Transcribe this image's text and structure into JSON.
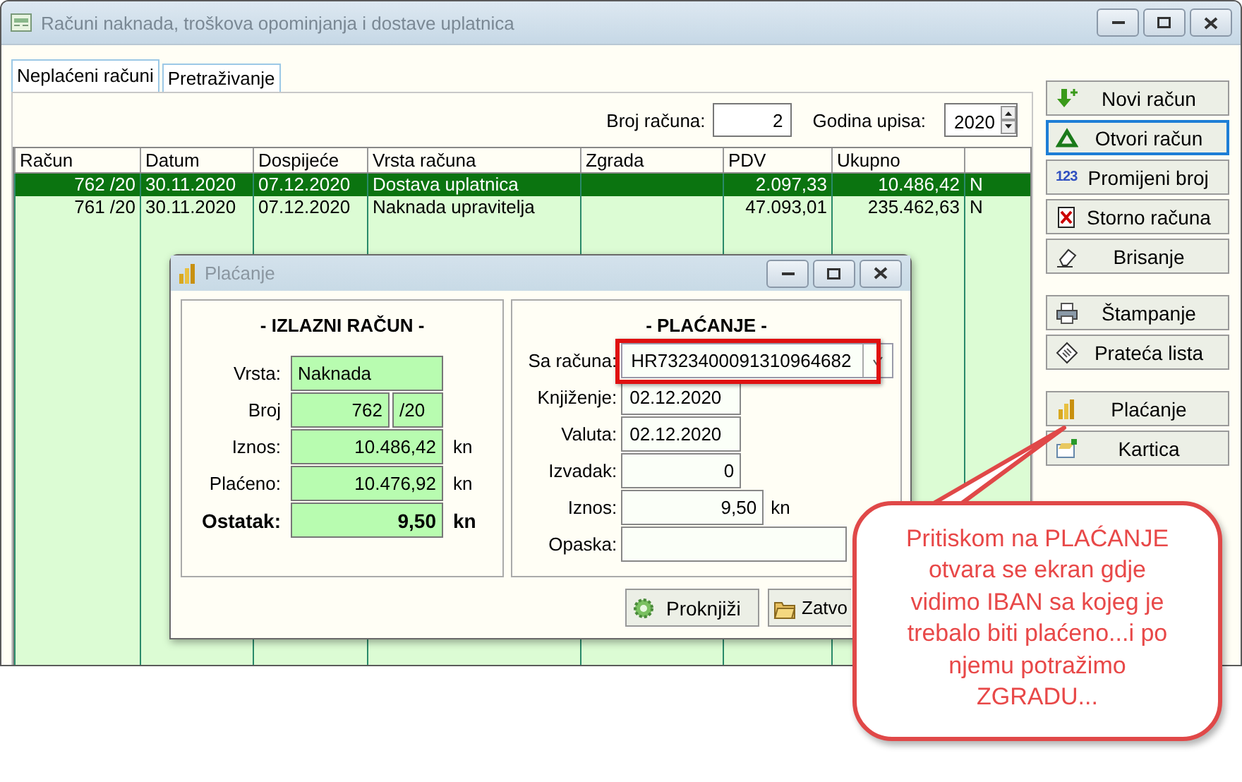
{
  "window": {
    "title": "Računi naknada, troškova opominjanja i dostave uplatnica"
  },
  "tabs": [
    {
      "label": "Neplaćeni računi",
      "selected": true
    },
    {
      "label": "Pretraživanje",
      "selected": false
    }
  ],
  "filters": {
    "count_label": "Broj računa:",
    "count": "2",
    "year_label": "Godina upisa:",
    "year": "2020"
  },
  "table": {
    "columns": [
      "Račun",
      "Datum",
      "Dospijeće",
      "Vrsta računa",
      "Zgrada",
      "PDV",
      "Ukupno"
    ],
    "rows": [
      {
        "selected": true,
        "cells": [
          "762 /20",
          "30.11.2020",
          "07.12.2020",
          "Dostava uplatnica",
          "",
          "2.097,33",
          "10.486,42",
          "N"
        ]
      },
      {
        "selected": false,
        "cells": [
          "761 /20",
          "30.11.2020",
          "07.12.2020",
          "Naknada upravitelja",
          "",
          "47.093,01",
          "235.462,63",
          "N"
        ]
      }
    ]
  },
  "action_groups": [
    [
      {
        "label": "Novi račun",
        "kind": "add",
        "focused": false
      },
      {
        "label": "Otvori račun",
        "kind": "open",
        "focused": true
      },
      {
        "label": "Promijeni broj",
        "kind": "digits",
        "icon_text": "123",
        "focused": false
      },
      {
        "label": "Storno računa",
        "kind": "cancel",
        "focused": false
      },
      {
        "label": "Brisanje",
        "kind": "erase",
        "focused": false
      }
    ],
    [
      {
        "label": "Štampanje",
        "kind": "print",
        "focused": false
      },
      {
        "label": "Prateća lista",
        "kind": "list",
        "focused": false
      }
    ],
    [
      {
        "label": "Plaćanje",
        "kind": "pay",
        "focused": false
      },
      {
        "label": "Kartica",
        "kind": "card",
        "focused": false
      }
    ]
  ],
  "dialog": {
    "title": "Plaćanje",
    "invoice": {
      "heading": "- IZLAZNI RAČUN -",
      "fields": [
        {
          "label": "Vrsta:",
          "kind": "text",
          "value": "Naknada"
        },
        {
          "label": "Broj",
          "kind": "split",
          "value": "762",
          "suffix": "/20"
        },
        {
          "label": "Iznos:",
          "kind": "amount",
          "value": "10.486,42",
          "unit": "kn"
        },
        {
          "label": "Plaćeno:",
          "kind": "amount",
          "value": "10.476,92",
          "unit": "kn"
        },
        {
          "label": "Ostatak:",
          "kind": "total",
          "value": "9,50",
          "unit": "kn"
        }
      ]
    },
    "payment": {
      "heading": "- PLAĆANJE -",
      "fields": [
        {
          "label": "Sa računa:",
          "kind": "combo",
          "value": "HR7323400091310964682",
          "highlighted": true
        },
        {
          "label": "Knjiženje:",
          "kind": "date",
          "value": "02.12.2020"
        },
        {
          "label": "Valuta:",
          "kind": "date",
          "value": "02.12.2020"
        },
        {
          "label": "Izvadak:",
          "kind": "number",
          "value": "0"
        },
        {
          "label": "Iznos:",
          "kind": "amount",
          "value": "9,50",
          "unit": "kn"
        },
        {
          "label": "Opaska:",
          "kind": "note"
        }
      ]
    },
    "buttons": [
      {
        "label": "Proknjiži",
        "kind": "post"
      },
      {
        "label": "Zatvo",
        "kind": "close"
      }
    ]
  },
  "callout": {
    "lines": [
      "Pritiskom na PLAĆANJE",
      "otvara se ekran gdje",
      "vidimo IBAN sa kojeg je",
      "trebalo biti plaćeno...i po",
      "njemu potražimo",
      "ZGRADU..."
    ]
  }
}
